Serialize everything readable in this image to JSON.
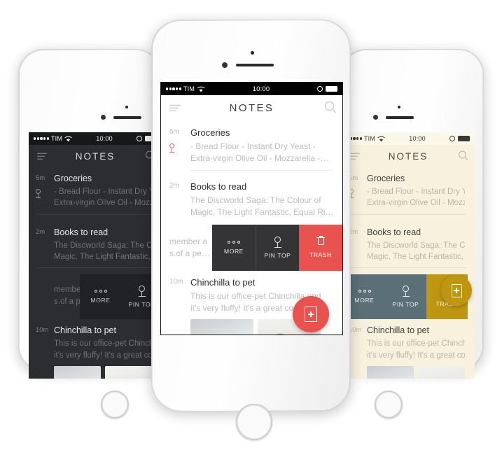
{
  "app": {
    "title": "NOTES",
    "icons": {
      "menu": "hamburger-menu-icon",
      "search": "search-icon",
      "compose": "new-note-icon"
    }
  },
  "status_bar": {
    "signal_dots": 5,
    "carrier": "TIM",
    "wifi": "wifi-icon",
    "time": "10:00",
    "alarm": "alarm-clock-icon",
    "battery": "battery-full-icon"
  },
  "notes": [
    {
      "time": "5m",
      "title": "Groceries",
      "pinned": true,
      "snippet_line1": "- Bread Flour - Instant Dry Yeast -",
      "snippet_line2": "Extra-virgin Olive Oil - Mozzarella -…"
    },
    {
      "time": "2m",
      "title": "Books to read",
      "pinned": false,
      "snippet_line1": "The Discworld Saga: The Colour of",
      "snippet_line2": "Magic, The Light Fantastic, Equal Ri…"
    },
    {
      "time": "",
      "title": "",
      "pinned": false,
      "snippet_line1": "member a",
      "snippet_line2": "s.of a pe…"
    },
    {
      "time": "10m",
      "title": "Chinchilla to pet",
      "pinned": false,
      "snippet_line1": "This is our office-pet Chinchilla and",
      "snippet_line2": "it's very fluffy! It's a great companio…"
    }
  ],
  "swipe_actions": [
    {
      "label": "MORE",
      "icon": "more-dots-icon"
    },
    {
      "label": "PIN TOP",
      "icon": "pin-icon"
    },
    {
      "label": "TRASH",
      "icon": "trash-icon"
    }
  ],
  "themes": {
    "dark": {
      "name": "dark",
      "bg": "#2b2d30",
      "statusbar_bg": "#17181a",
      "statusbar_fg": "#f2f2f2",
      "title": "#d8d9da",
      "icon": "#8d9094",
      "note_title": "#e8e9ea",
      "note_time": "#7d8084",
      "snippet": "#6e7175",
      "divider": "#3a3d41",
      "pin": "#8d9094",
      "action_bg": "#212225",
      "action_fg": "#c9cbcd",
      "trash_bg": "#212225",
      "fab_bg": "#d94f4f"
    },
    "light": {
      "name": "light",
      "bg": "#ffffff",
      "statusbar_bg": "#000000",
      "statusbar_fg": "#ffffff",
      "title": "#3c3c3c",
      "icon": "#b9b9b9",
      "note_title": "#2e2e2e",
      "note_time": "#bdbdbd",
      "snippet": "#bdbdbd",
      "divider": "#ececec",
      "pin": "#e2607a",
      "action_bg": "#343436",
      "action_fg": "#e6e6e6",
      "trash_bg": "#e9524f",
      "fab_bg": "#e9524f"
    },
    "sepia": {
      "name": "sepia",
      "bg": "#f7f1de",
      "statusbar_bg": "#fbf7e9",
      "statusbar_fg": "#3a3a36",
      "title": "#4a4a44",
      "icon": "#b5b1a0",
      "note_title": "#3f3f3a",
      "note_time": "#bcb7a4",
      "snippet": "#bcb7a4",
      "divider": "#e7e0c9",
      "pin": "#c0a95e",
      "action_bg": "#5b6f77",
      "action_fg": "#eef0f0",
      "trash_bg": "#bf9612",
      "fab_bg": "#bf9612"
    }
  }
}
